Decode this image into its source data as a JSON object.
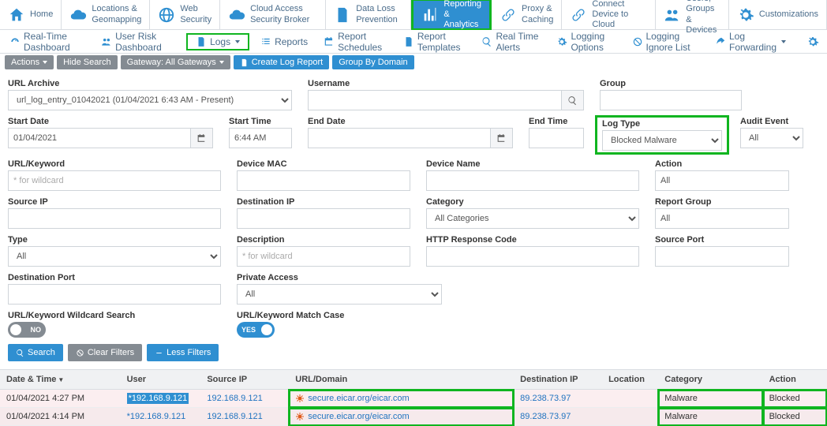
{
  "topnav": [
    {
      "label": "Home",
      "icon": "home"
    },
    {
      "label": "Locations & Geomapping",
      "icon": "cloud-pin"
    },
    {
      "label": "Web Security",
      "icon": "globe"
    },
    {
      "label": "Cloud Access Security Broker",
      "icon": "casb"
    },
    {
      "label": "Data Loss Prevention",
      "icon": "shield-doc"
    },
    {
      "label": "Reporting & Analytics",
      "icon": "chart",
      "active": true
    },
    {
      "label": "Proxy & Caching",
      "icon": "proxy"
    },
    {
      "label": "Connect Device to Cloud",
      "icon": "connect"
    },
    {
      "label": "Users, Groups & Devices",
      "icon": "users"
    },
    {
      "label": "Customizations",
      "icon": "gear-lg"
    }
  ],
  "subnav": [
    {
      "label": "Real-Time Dashboard",
      "icon": "gauge"
    },
    {
      "label": "User Risk Dashboard",
      "icon": "user-risk"
    },
    {
      "label": "Logs",
      "icon": "log",
      "active": true,
      "caret": true
    },
    {
      "label": "Reports",
      "icon": "list"
    },
    {
      "label": "Report Schedules",
      "icon": "calendar"
    },
    {
      "label": "Report Templates",
      "icon": "template"
    },
    {
      "label": "Real Time Alerts",
      "icon": "alert"
    },
    {
      "label": "Logging Options",
      "icon": "options"
    },
    {
      "label": "Logging Ignore List",
      "icon": "ignore"
    },
    {
      "label": "Log Forwarding",
      "icon": "forward",
      "caret": true
    }
  ],
  "actionbar": {
    "actions": "Actions",
    "hide": "Hide Search",
    "gateway": "Gateway: All Gateways",
    "create": "Create Log Report",
    "group": "Group By Domain"
  },
  "filters": {
    "url_archive": {
      "label": "URL Archive",
      "value": "url_log_entry_01042021 (01/04/2021 6:43 AM - Present)"
    },
    "username": {
      "label": "Username",
      "value": ""
    },
    "group": {
      "label": "Group",
      "value": ""
    },
    "start_date": {
      "label": "Start Date",
      "value": "01/04/2021"
    },
    "start_time": {
      "label": "Start Time",
      "value": "6:44 AM"
    },
    "end_date": {
      "label": "End Date",
      "value": ""
    },
    "end_time": {
      "label": "End Time",
      "value": ""
    },
    "log_type": {
      "label": "Log Type",
      "value": "Blocked Malware"
    },
    "audit_event": {
      "label": "Audit Event",
      "value": "All"
    },
    "url_keyword": {
      "label": "URL/Keyword",
      "placeholder": "* for wildcard",
      "value": ""
    },
    "device_mac": {
      "label": "Device MAC",
      "value": ""
    },
    "device_name": {
      "label": "Device Name",
      "value": ""
    },
    "action": {
      "label": "Action",
      "value": "All"
    },
    "source_ip": {
      "label": "Source IP",
      "value": ""
    },
    "destination_ip": {
      "label": "Destination IP",
      "value": ""
    },
    "category": {
      "label": "Category",
      "value": "All Categories"
    },
    "report_group": {
      "label": "Report Group",
      "value": "All"
    },
    "type": {
      "label": "Type",
      "value": "All"
    },
    "description": {
      "label": "Description",
      "placeholder": "* for wildcard",
      "value": ""
    },
    "http_response": {
      "label": "HTTP Response Code",
      "value": ""
    },
    "source_port": {
      "label": "Source Port",
      "value": ""
    },
    "destination_port": {
      "label": "Destination Port",
      "value": ""
    },
    "private_access": {
      "label": "Private Access",
      "value": "All"
    },
    "wildcard_search": {
      "label": "URL/Keyword Wildcard Search",
      "value": "NO"
    },
    "match_case": {
      "label": "URL/Keyword Match Case",
      "value": "YES"
    }
  },
  "buttons": {
    "search": "Search",
    "clear": "Clear Filters",
    "less": "Less Filters"
  },
  "table": {
    "headers": [
      "Date & Time",
      "User",
      "Source IP",
      "URL/Domain",
      "Destination IP",
      "Location",
      "Category",
      "Action"
    ],
    "rows": [
      {
        "date": "01/04/2021 4:27 PM",
        "user": "*192.168.9.121",
        "user_selected": true,
        "source_ip": "192.168.9.121",
        "url": "secure.eicar.org/eicar.com",
        "dest_ip": "89.238.73.97",
        "location": "",
        "category": "Malware",
        "action": "Blocked"
      },
      {
        "date": "01/04/2021 4:14 PM",
        "user": "*192.168.9.121",
        "user_selected": false,
        "source_ip": "192.168.9.121",
        "url": "secure.eicar.org/eicar.com",
        "dest_ip": "89.238.73.97",
        "location": "",
        "category": "Malware",
        "action": "Blocked"
      }
    ]
  }
}
